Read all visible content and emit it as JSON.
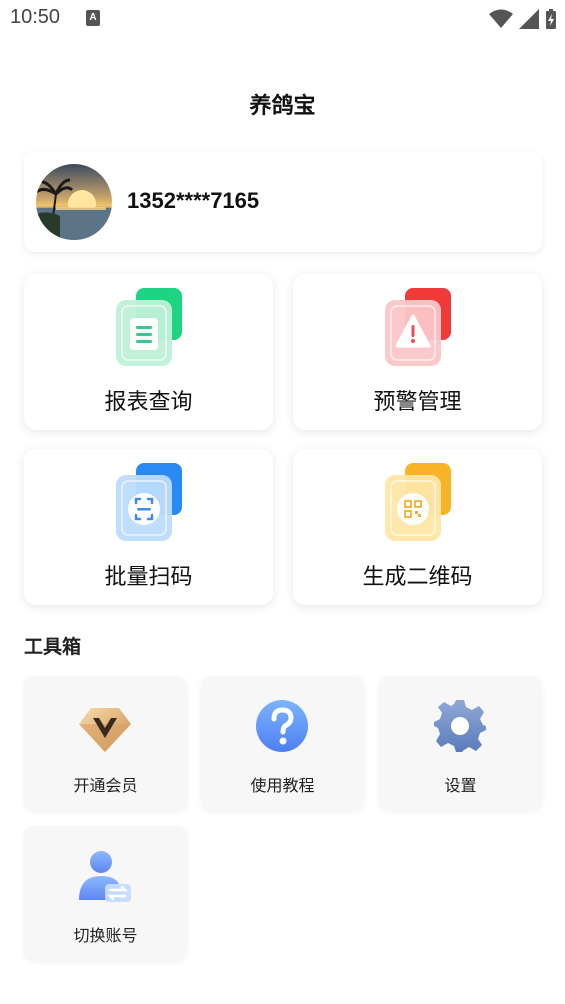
{
  "status_bar": {
    "time": "10:50",
    "notification_icon": "a-icon"
  },
  "header": {
    "title": "养鸽宝"
  },
  "user": {
    "phone": "1352****7165"
  },
  "functions": [
    {
      "label": "报表查询",
      "icon": "report-icon",
      "color": "#2ed18a"
    },
    {
      "label": "预警管理",
      "icon": "warning-icon",
      "color": "#f04848"
    },
    {
      "label": "批量扫码",
      "icon": "scan-icon",
      "color": "#3d8df5"
    },
    {
      "label": "生成二维码",
      "icon": "qrcode-icon",
      "color": "#f7b52c"
    }
  ],
  "toolbox": {
    "title": "工具箱",
    "items": [
      {
        "label": "开通会员",
        "icon": "vip-icon"
      },
      {
        "label": "使用教程",
        "icon": "help-icon"
      },
      {
        "label": "设置",
        "icon": "gear-icon"
      },
      {
        "label": "切换账号",
        "icon": "switch-account-icon"
      }
    ]
  }
}
